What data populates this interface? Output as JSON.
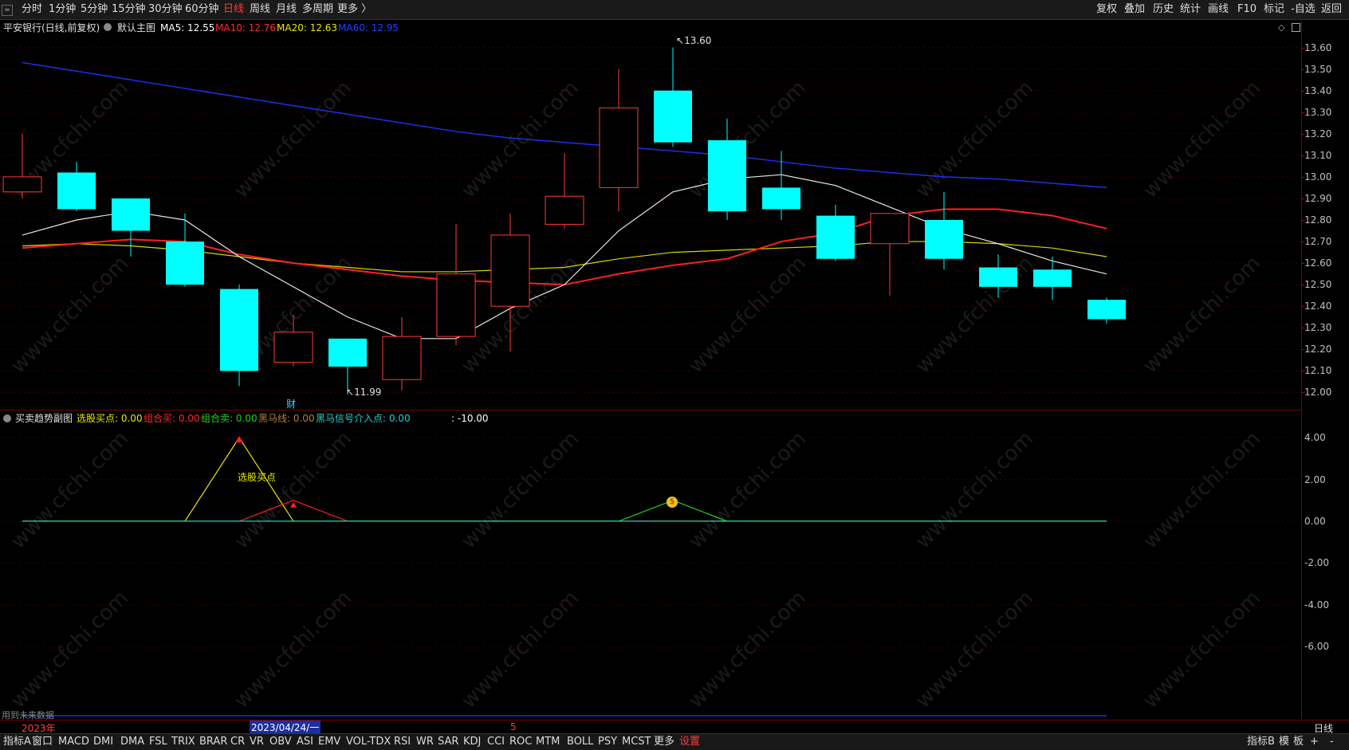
{
  "topbar": {
    "periods": [
      "分时",
      "1分钟",
      "5分钟",
      "15分钟",
      "30分钟",
      "60分钟",
      "日线",
      "周线",
      "月线",
      "多周期",
      "更多 〉"
    ],
    "active_period": "日线",
    "right_buttons": [
      "复权",
      "叠加",
      "历史",
      "统计",
      "画线",
      "F10",
      "标记",
      "-自选",
      "返回"
    ]
  },
  "main_chart": {
    "stock_title": "平安银行(日线,前复权)",
    "template": "默认主图",
    "ma": [
      {
        "label": "MA5: 12.55",
        "color": "#ffffff"
      },
      {
        "label": "MA10: 12.76",
        "color": "#ff2a2a"
      },
      {
        "label": "MA20: 12.63",
        "color": "#e8e800"
      },
      {
        "label": "MA60: 12.95",
        "color": "#2040ff"
      }
    ],
    "high_label": "13.60",
    "low_label": "11.99",
    "fin_marker": "财",
    "y_axis": [
      "13.60",
      "13.50",
      "13.40",
      "13.30",
      "13.20",
      "13.10",
      "13.00",
      "12.90",
      "12.80",
      "12.70",
      "12.60",
      "12.50",
      "12.40",
      "12.30",
      "12.20",
      "12.10",
      "12.00"
    ]
  },
  "chart_data": {
    "type": "candlestick",
    "ylim": [
      11.95,
      13.65
    ],
    "candles": [
      {
        "o": 13.0,
        "h": 13.2,
        "l": 12.9,
        "c": 12.93,
        "dir": "up"
      },
      {
        "o": 13.02,
        "h": 13.07,
        "l": 12.84,
        "c": 12.85,
        "dir": "down"
      },
      {
        "o": 12.9,
        "h": 12.9,
        "l": 12.63,
        "c": 12.75,
        "dir": "down"
      },
      {
        "o": 12.7,
        "h": 12.83,
        "l": 12.49,
        "c": 12.5,
        "dir": "down"
      },
      {
        "o": 12.48,
        "h": 12.5,
        "l": 12.03,
        "c": 12.1,
        "dir": "down"
      },
      {
        "o": 12.14,
        "h": 12.36,
        "l": 12.12,
        "c": 12.28,
        "dir": "up"
      },
      {
        "o": 12.25,
        "h": 12.25,
        "l": 11.99,
        "c": 12.12,
        "dir": "down"
      },
      {
        "o": 12.06,
        "h": 12.35,
        "l": 12.01,
        "c": 12.26,
        "dir": "up"
      },
      {
        "o": 12.26,
        "h": 12.78,
        "l": 12.22,
        "c": 12.55,
        "dir": "up"
      },
      {
        "o": 12.4,
        "h": 12.83,
        "l": 12.19,
        "c": 12.73,
        "dir": "up"
      },
      {
        "o": 12.78,
        "h": 13.11,
        "l": 12.76,
        "c": 12.91,
        "dir": "up"
      },
      {
        "o": 12.95,
        "h": 13.5,
        "l": 12.84,
        "c": 13.32,
        "dir": "up"
      },
      {
        "o": 13.4,
        "h": 13.6,
        "l": 13.14,
        "c": 13.16,
        "dir": "down"
      },
      {
        "o": 13.17,
        "h": 13.27,
        "l": 12.8,
        "c": 12.84,
        "dir": "down"
      },
      {
        "o": 12.95,
        "h": 13.12,
        "l": 12.8,
        "c": 12.85,
        "dir": "down"
      },
      {
        "o": 12.82,
        "h": 12.87,
        "l": 12.61,
        "c": 12.62,
        "dir": "down"
      },
      {
        "o": 12.69,
        "h": 12.83,
        "l": 12.45,
        "c": 12.83,
        "dir": "up"
      },
      {
        "o": 12.8,
        "h": 12.93,
        "l": 12.57,
        "c": 12.62,
        "dir": "down"
      },
      {
        "o": 12.58,
        "h": 12.64,
        "l": 12.44,
        "c": 12.49,
        "dir": "down"
      },
      {
        "o": 12.57,
        "h": 12.63,
        "l": 12.43,
        "c": 12.49,
        "dir": "down"
      },
      {
        "o": 12.43,
        "h": 12.44,
        "l": 12.32,
        "c": 12.34,
        "dir": "down"
      }
    ],
    "ma5": [
      12.73,
      12.8,
      12.84,
      12.8,
      12.63,
      12.49,
      12.35,
      12.25,
      12.25,
      12.39,
      12.5,
      12.75,
      12.93,
      12.99,
      13.01,
      12.96,
      12.86,
      12.76,
      12.69,
      12.61,
      12.55
    ],
    "ma10": [
      12.67,
      12.69,
      12.71,
      12.7,
      12.64,
      12.6,
      12.57,
      12.54,
      12.52,
      12.51,
      12.5,
      12.55,
      12.59,
      12.62,
      12.7,
      12.74,
      12.82,
      12.85,
      12.85,
      12.82,
      12.76
    ],
    "ma20": [
      12.68,
      12.69,
      12.68,
      12.66,
      12.63,
      12.6,
      12.58,
      12.56,
      12.56,
      12.57,
      12.58,
      12.62,
      12.65,
      12.66,
      12.67,
      12.68,
      12.7,
      12.7,
      12.69,
      12.67,
      12.63
    ],
    "ma60": [
      13.53,
      13.49,
      13.45,
      13.41,
      13.37,
      13.33,
      13.29,
      13.25,
      13.21,
      13.18,
      13.16,
      13.14,
      13.12,
      13.1,
      13.07,
      13.04,
      13.02,
      13.0,
      12.99,
      12.97,
      12.95
    ]
  },
  "sub_chart": {
    "title": "买卖趋势副图",
    "indicators": [
      {
        "label": "选股买点: 0.00",
        "color": "#e8e800"
      },
      {
        "label": "组合买: 0.00",
        "color": "#ff2a2a"
      },
      {
        "label": "组合卖: 0.00",
        "color": "#20d020"
      },
      {
        "label": "黑马线: 0.00",
        "color": "#b08040"
      },
      {
        "label": "黑马信号介入点: 0.00",
        "color": "#20d0d0"
      },
      {
        "label": ": -10.00",
        "color": "#ffffff"
      }
    ],
    "annotation": "选股买点",
    "y_axis": [
      "4.00",
      "2.00",
      "0.00",
      "-2.00",
      "-4.00",
      "-6.00"
    ],
    "ylim": [
      -9.5,
      5.3
    ],
    "select_buy": [
      0,
      0,
      0,
      0,
      4,
      0,
      0,
      0,
      0,
      0,
      0,
      0,
      0,
      0,
      0,
      0,
      0,
      0,
      0,
      0,
      0
    ],
    "combo_buy": [
      0,
      0,
      0,
      0,
      0,
      1,
      0,
      0,
      0,
      0,
      0,
      0,
      0,
      0,
      0,
      0,
      0,
      0,
      0,
      0,
      0
    ],
    "combo_sell": [
      0,
      0,
      0,
      0,
      0,
      0,
      0,
      0,
      0,
      0,
      0,
      0,
      1,
      0,
      0,
      0,
      0,
      0,
      0,
      0,
      0
    ],
    "footnote": "用到未来数据"
  },
  "timeline": {
    "year": "2023年",
    "cursor_date": "2023/04/24/一",
    "month_mark": "5",
    "period_label": "日线"
  },
  "bottombar": {
    "tabs": [
      "指标A",
      "窗口",
      "MACD",
      "DMI",
      "DMA",
      "FSL",
      "TRIX",
      "BRAR",
      "CR",
      "VR",
      "OBV",
      "ASI",
      "EMV",
      "VOL-TDX",
      "RSI",
      "WR",
      "SAR",
      "KDJ",
      "CCI",
      "ROC",
      "MTM",
      "BOLL",
      "PSY",
      "MCST",
      "更多",
      "设置"
    ],
    "right_tabs": [
      "指标B",
      "模",
      "板",
      "+",
      "-"
    ]
  },
  "watermark": "www.cfchi.com"
}
